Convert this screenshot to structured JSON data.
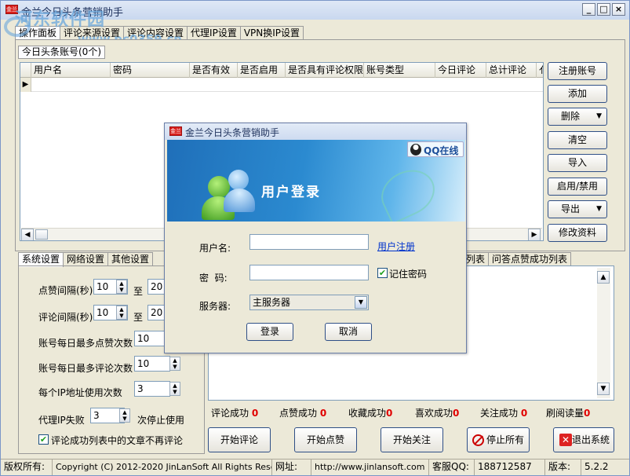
{
  "window": {
    "title": "金兰今日头条营销助手",
    "watermark": "河东软件园",
    "watermark_url": "www.pc0359.cn"
  },
  "main_tabs": [
    "操作面板",
    "评论来源设置",
    "评论内容设置",
    "代理IP设置",
    "VPN换IP设置"
  ],
  "accounts": {
    "group_label": "今日头条账号(0个)",
    "columns": [
      "用户名",
      "密码",
      "是否有效",
      "是否启用",
      "是否具有评论权限",
      "账号类型",
      "今日评论",
      "总计评论",
      "亻"
    ]
  },
  "side_buttons": [
    "注册账号",
    "添加",
    "删除",
    "清空",
    "导入",
    "启用/禁用",
    "导出",
    "修改资料"
  ],
  "settings_tabs": [
    "系统设置",
    "网络设置",
    "其他设置"
  ],
  "settings": {
    "like_interval_label": "点赞间隔(秒)",
    "like_interval_from": "10",
    "to_label": "至",
    "like_interval_to": "20",
    "comment_interval_label": "评论间隔(秒)",
    "comment_interval_from": "10",
    "comment_interval_to": "20",
    "daily_likes_label": "账号每日最多点赞次数",
    "daily_likes": "10",
    "daily_comments_label": "账号每日最多评论次数",
    "daily_comments": "10",
    "ip_use_label": "每个IP地址使用次数",
    "ip_use": "3",
    "proxy_fail_label": "代理IP失败",
    "proxy_fail": "3",
    "proxy_fail_suffix": "次停止使用",
    "no_repeat_label": "评论成功列表中的文章不再评论"
  },
  "result_tabs": [
    "列表",
    "问答点赞成功列表"
  ],
  "stats": [
    {
      "label": "评论成功",
      "value": "0"
    },
    {
      "label": "点赞成功",
      "value": "0"
    },
    {
      "label": "收藏成功",
      "value": "0"
    },
    {
      "label": "喜欢成功",
      "value": "0"
    },
    {
      "label": "关注成功",
      "value": "0"
    },
    {
      "label": "刷阅读量",
      "value": "0"
    }
  ],
  "action_buttons": {
    "start_comment": "开始评论",
    "start_like": "开始点赞",
    "start_follow": "开始关注",
    "stop_all": "停止所有",
    "exit": "退出系统"
  },
  "status_bar": {
    "copyright_label": "版权所有:",
    "copyright": "Copyright (C) 2012-2020 JinLanSoft All Rights Reserved.",
    "site_label": "网址:",
    "site": "http://www.jinlansoft.com",
    "qq_label": "客服QQ:",
    "qq": "188712587",
    "version_label": "版本:",
    "version": "5.2.2"
  },
  "login_dialog": {
    "title": "金兰今日头条营销助手",
    "qq_online": "QQ在线",
    "banner_text": "用户登录",
    "username_label": "用户名:",
    "username": "",
    "register_link": "用户注册",
    "password_label": "密  码:",
    "password": "",
    "remember_label": "记住密码",
    "server_label": "服务器:",
    "server": "主服务器",
    "login_button": "登录",
    "cancel_button": "取消"
  },
  "colors": {
    "accent": "#2f4f86",
    "stat_value": "#e00000",
    "banner": "#2b8ad0"
  }
}
